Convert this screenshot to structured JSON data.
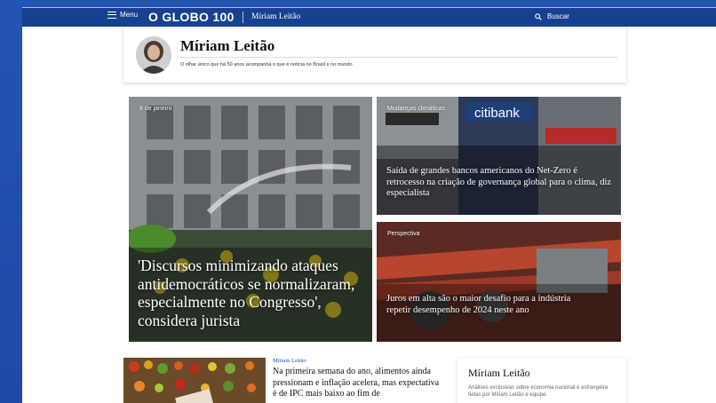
{
  "header": {
    "menu_label": "Menu",
    "logo_text": "O GLOBO 100",
    "section_name": "Míriam Leitão",
    "search_label": "Buscar"
  },
  "author": {
    "name": "Míriam Leitão",
    "description": "O olhar único que há 50 anos acompanha o que é notícia no Brasil e no mundo"
  },
  "featured": [
    {
      "kicker": "8 de janeiro",
      "headline": "'Discursos minimizando ataques antidemocráticos se normalizaram, especialmente no Congresso', considera jurista"
    },
    {
      "kicker": "Mudanças climáticas",
      "headline": "Saída de grandes bancos americanos do Net-Zero é retrocesso na criação de governança global para o clima, diz especialista"
    },
    {
      "kicker": "Perspectiva",
      "headline": "Juros em alta são o maior desafio para a indústria repetir desempenho de 2024 neste ano"
    }
  ],
  "latest": {
    "kicker": "Míriam Leitão",
    "headline": "Na primeira semana do ano, alimentos ainda pressionam e inflação acelera, mas expectativa é de IPC mais baixo ao fim de"
  },
  "sidebar": {
    "title": "Míriam Leitão",
    "description": "Análises exclusivas sobre economia nacional e estrangeira feitas por Míriam Leitão e equipe."
  },
  "colors": {
    "nav_background": "#16418f",
    "frame_background": "#1f4fb0",
    "kicker_accent": "#1a4fb3"
  }
}
